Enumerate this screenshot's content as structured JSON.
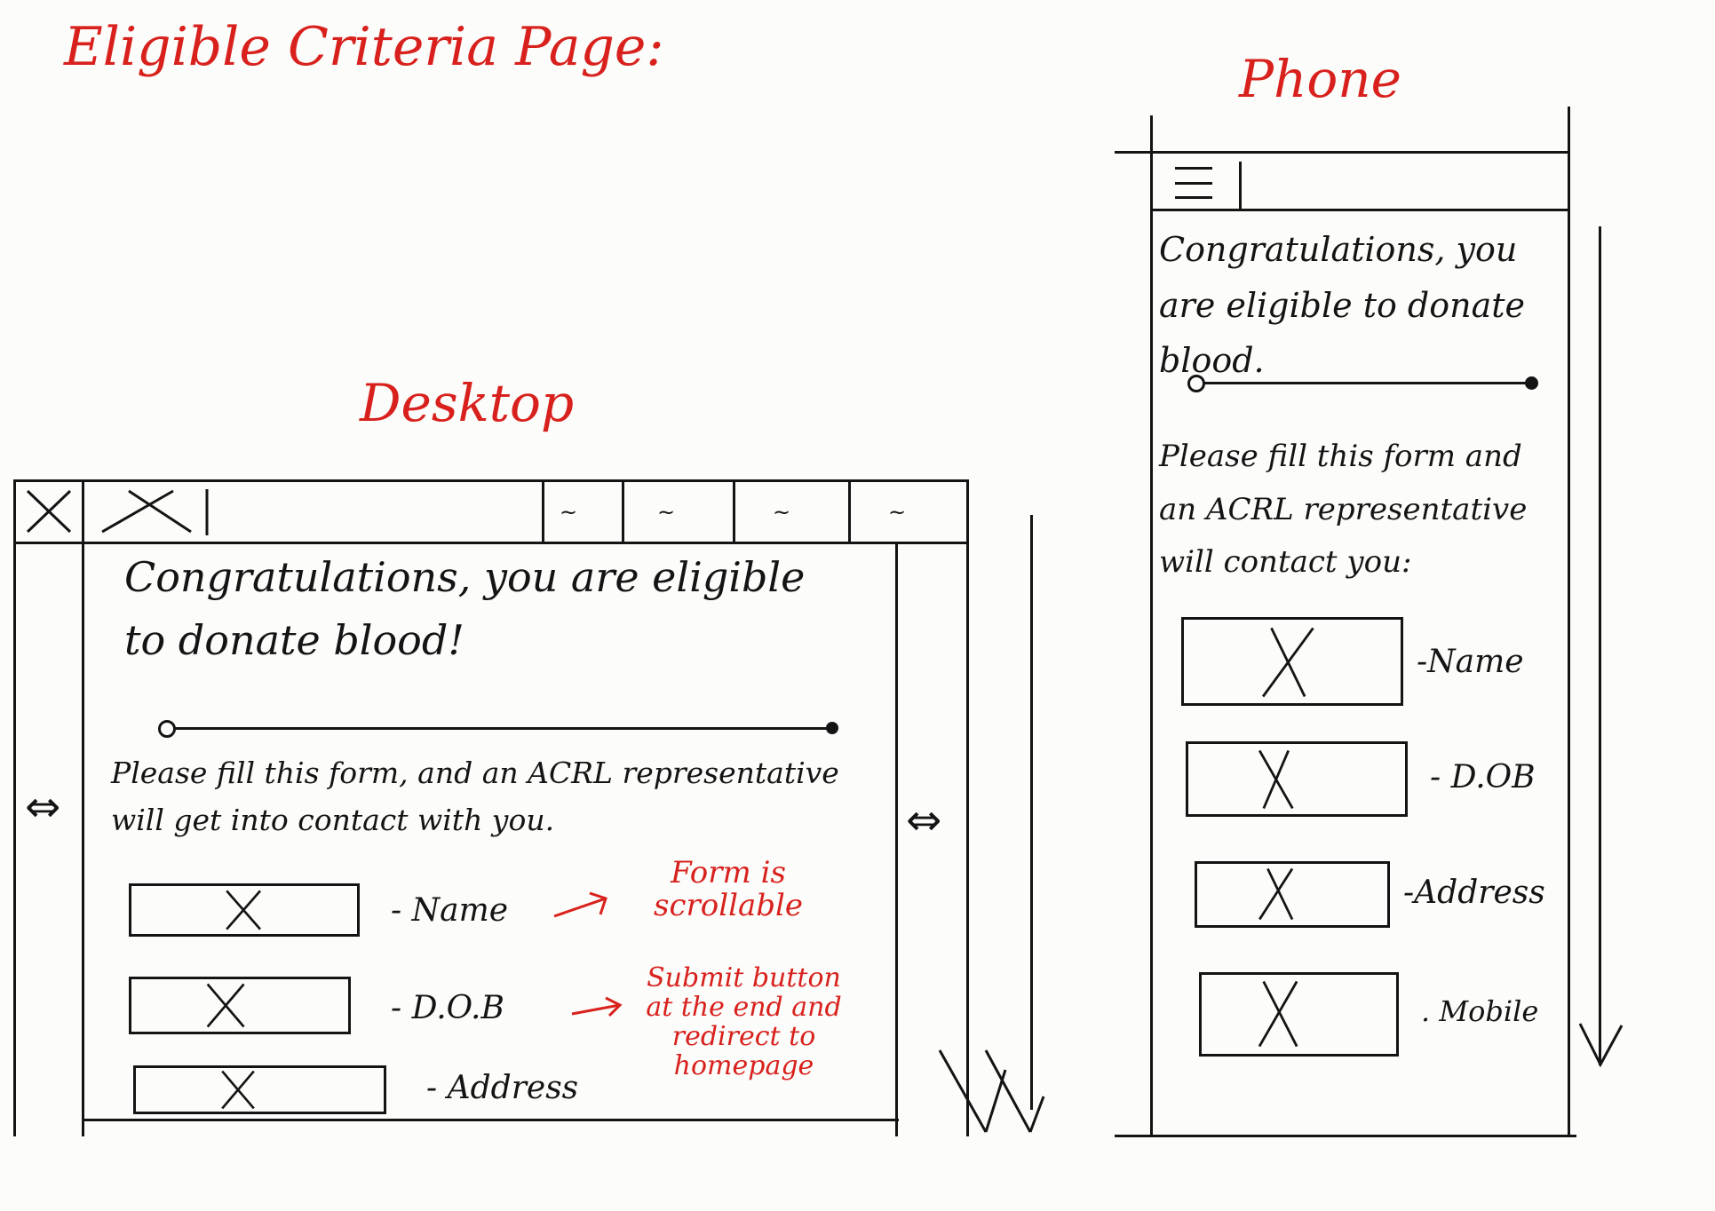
{
  "page_title": "Eligible Criteria Page:",
  "colors": {
    "ink": "#141414",
    "annotation": "#d8211d"
  },
  "desktop": {
    "label": "Desktop",
    "header_tabs": [
      "~",
      "~",
      "~",
      "~"
    ],
    "heading": "Congratulations, you are eligible to donate blood!",
    "instruction": "Please fill this form, and an ACRL representative will get into contact with you.",
    "fields": [
      {
        "label": "- Name",
        "placeholder_icon": "x-mark-icon"
      },
      {
        "label": "- D.O.B",
        "placeholder_icon": "x-mark-icon"
      },
      {
        "label": "- Address",
        "placeholder_icon": "x-mark-icon"
      }
    ],
    "side_arrow_icon": "left-right-arrow-icon"
  },
  "annotations": [
    {
      "text": "Form is scrollable"
    },
    {
      "text": "Submit button at the end and redirect to homepage"
    }
  ],
  "phone": {
    "label": "Phone",
    "menu_icon": "hamburger-menu-icon",
    "heading": "Congratulations, you are eligible to donate blood.",
    "instruction": "Please fill this form and an ACRL representative will contact you:",
    "fields": [
      {
        "label": "-Name",
        "placeholder_icon": "x-mark-icon"
      },
      {
        "label": "- D.OB",
        "placeholder_icon": "x-mark-icon"
      },
      {
        "label": "-Address",
        "placeholder_icon": "x-mark-icon"
      },
      {
        "label": ". Mobile",
        "placeholder_icon": "x-mark-icon"
      }
    ],
    "scroll_arrow_icon": "down-arrow-icon"
  }
}
